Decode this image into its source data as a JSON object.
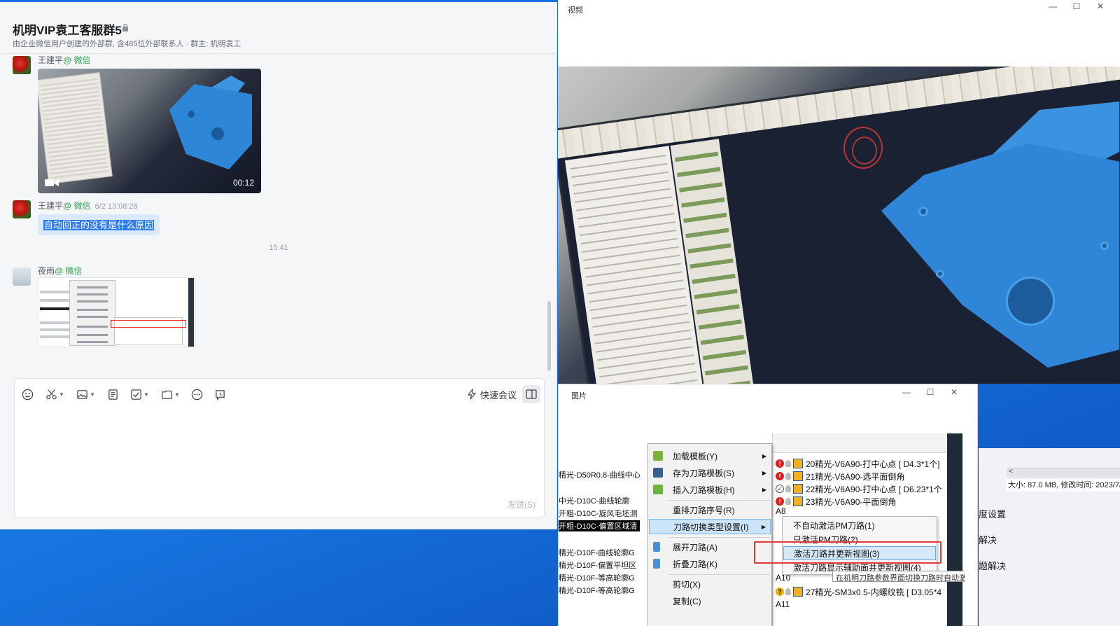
{
  "chat": {
    "title": "机明VIP袁工客服群5",
    "subtitle": "由企业微信用户创建的外部群, 含485位外部联系人 · 群主: 机明袁工",
    "messages": [
      {
        "sender": "王建平",
        "tag": "@ 微信",
        "time": "",
        "video_duration": "00:12"
      },
      {
        "sender": "王建平",
        "tag": "@ 微信",
        "time": "6/2 13:08:28",
        "text": "自动回正的没有是什么原因"
      },
      {
        "sender": "夜雨",
        "tag": "@ 微信",
        "time": ""
      }
    ],
    "center_time": "15:41",
    "toolbar": {
      "icons": [
        "emoji-icon",
        "scissors-icon",
        "image-icon",
        "document-icon",
        "checkbox-icon",
        "folder-icon",
        "more-icon",
        "chat-history-icon"
      ],
      "quick_meeting": "快速会议"
    },
    "send_label": "发送(S)"
  },
  "video_window": {
    "title": "视频",
    "controls": [
      "—",
      "☐",
      "✕"
    ]
  },
  "image_window": {
    "title": "图片",
    "controls": [
      "—",
      "☐",
      "✕"
    ],
    "tree_items": [
      "精光-D50R0.8-曲线中心",
      "中光-D10C-曲线轮廓",
      "开粗-D10C-旋风毛坯测",
      "开粗-D10C-偏置区域清",
      "精光-D10F-曲线轮廓G",
      "精光-D10F-偏置平坦区",
      "精光-D10F-等高轮廓G",
      "精光-D10F-等高轮廓G"
    ],
    "context_menu": [
      {
        "label": "加载模板(Y)",
        "submenu": true
      },
      {
        "label": "存为刀路模板(S)",
        "submenu": true
      },
      {
        "label": "插入刀路模板(H)",
        "submenu": true
      },
      {
        "label": "重排刀路序号(R)",
        "submenu": false
      },
      {
        "label": "刀路切换类型设置(I)",
        "submenu": true
      },
      {
        "label": "展开刀路(A)",
        "submenu": false
      },
      {
        "label": "折叠刀路(K)",
        "submenu": false
      },
      {
        "label": "剪切(X)",
        "submenu": false
      },
      {
        "label": "复制(C)",
        "submenu": false
      }
    ],
    "toolpaths": [
      "20精光-V6A90-打中心点 [ D4.3*1个]",
      "21精光-V6A90-选平面倒角",
      "22精光-V6A90-打中心点 [ D6.23*1个",
      "23精光-V6A90-平面倒角",
      "A8",
      "A10",
      "27精光-SM3x0.5-内螺纹铣 [ D3.05*4",
      "A11"
    ],
    "submenu": [
      "不自动激活PM刀路(1)",
      "只激活PM刀路(2)",
      "激活刀路并更新视图(3)",
      "激活刀路显示辅助面并更新视图(4)"
    ],
    "tooltip": "在机明刀路参数界面切换刀路时自动激"
  },
  "background_window": {
    "info": "大小: 87.0 MB, 修改时间: 2023/7/",
    "arrow": "<",
    "items": [
      "度设置",
      "解决",
      "题解决"
    ]
  }
}
